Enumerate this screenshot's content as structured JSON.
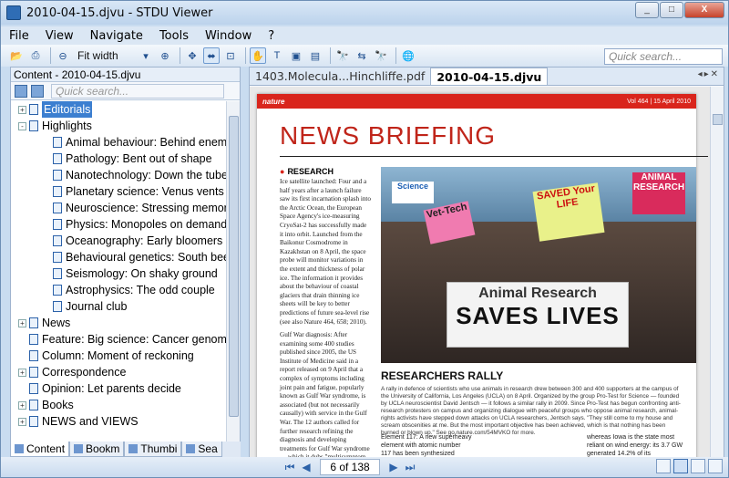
{
  "window": {
    "title": "2010-04-15.djvu - STDU Viewer",
    "buttons": [
      "_",
      "□",
      "X"
    ]
  },
  "menu": [
    "File",
    "View",
    "Navigate",
    "Tools",
    "Window",
    "?"
  ],
  "toolbar": {
    "fit_width": "Fit width",
    "search_placeholder": "Quick search..."
  },
  "left": {
    "title": "Content - 2010-04-15.djvu",
    "search_placeholder": "Quick search...",
    "tree": [
      {
        "label": "Editorials",
        "level": 0,
        "expand": "+",
        "selected": true
      },
      {
        "label": "Highlights",
        "level": 0,
        "expand": "-"
      },
      {
        "label": "Animal behaviour: Behind enemy",
        "level": 1
      },
      {
        "label": "Pathology: Bent out of shape",
        "level": 1
      },
      {
        "label": "Nanotechnology: Down the tube",
        "level": 1
      },
      {
        "label": "Planetary science: Venus vents",
        "level": 1
      },
      {
        "label": "Neuroscience: Stressing memory",
        "level": 1
      },
      {
        "label": "Physics: Monopoles on demand",
        "level": 1
      },
      {
        "label": "Oceanography: Early bloomers",
        "level": 1
      },
      {
        "label": "Behavioural genetics: South bee-",
        "level": 1
      },
      {
        "label": "Seismology: On shaky ground",
        "level": 1
      },
      {
        "label": "Astrophysics: The odd couple",
        "level": 1
      },
      {
        "label": "Journal club",
        "level": 1
      },
      {
        "label": "News",
        "level": 0,
        "expand": "+"
      },
      {
        "label": "Feature: Big science: Cancer genom",
        "level": 0
      },
      {
        "label": "Column: Moment of reckoning",
        "level": 0
      },
      {
        "label": "Correspondence",
        "level": 0,
        "expand": "+"
      },
      {
        "label": "Opinion: Let parents decide",
        "level": 0
      },
      {
        "label": "Books",
        "level": 0,
        "expand": "+"
      },
      {
        "label": "NEWS and VIEWS",
        "level": 0,
        "expand": "+"
      }
    ],
    "tabs": [
      "Content",
      "Bookm",
      "Thumbi",
      "Sea"
    ]
  },
  "doc_tabs": [
    "1403.Molecula...Hinchliffe.pdf",
    "2010-04-15.djvu"
  ],
  "page": {
    "header_left": "nature",
    "header_right": "Vol 464 | 15 April 2010",
    "heading": "NEWS BRIEFING",
    "section": "RESEARCH",
    "article1": "Ice satellite launched: Four and a half years after a launch failure saw its first incarnation splash into the Arctic Ocean, the European Space Agency's ice-measuring CryoSat-2 has successfully made it into orbit. Launched from the Baikonur Cosmodrome in Kazakhstan on 8 April, the space probe will monitor variations in the extent and thickness of polar ice. The information it provides about the behaviour of coastal glaciers that drain thinning ice sheets will be key to better predictions of future sea-level rise (see also Nature 464, 658; 2010).",
    "article2": "Gulf War diagnosis: After examining some 400 studies published since 2005, the US Institute of Medicine said in a report released on 9 April that a complex of symptoms including joint pain and fatigue, popularly known as Gulf War syndrome, is associated (but not necessarily causally) with service in the Gulf War. The 12 authors called for further research refining the diagnosis and developing treatments for Gulf War syndrome — which it dubs \"multisymptom illness\".",
    "banner_line1": "Animal Research",
    "banner_line2": "SAVES LIVES",
    "sign1": "Vet-Tech",
    "sign2": "SAVED Your LIFE",
    "sign3": "ANIMAL RESEARCH",
    "sign4": "Science",
    "rally_title": "RESEARCHERS RALLY",
    "rally_text": "A rally in defence of scientists who use animals in research drew between 300 and 400 supporters at the campus of the University of California, Los Angeles (UCLA) on 8 April. Organized by the group Pro-Test for Science — founded by UCLA neuroscientist David Jentsch — it follows a similar rally in 2009. Since Pro-Test has begun confronting anti-research protesters on campus and organizing dialogue with peaceful groups who oppose animal research, animal-rights activists have stepped down attacks on UCLA researchers, Jentsch says. \"They still come to my house and scream obscenities at me. But the most important objective has been achieved, which is that nothing has been burned or blown up.\" See go.nature.com/54MVKO for more.",
    "element": "Element 117: A new superheavy element with atomic number 117 has been synthesized",
    "iowa": "whereas Iowa is the state most reliant on wind energy: its 3.7 GW generated 14.2% of its"
  },
  "status": {
    "page": "6 of 138"
  },
  "colors": {
    "accent": "#3c7fd0",
    "nature_red": "#d9251c"
  }
}
